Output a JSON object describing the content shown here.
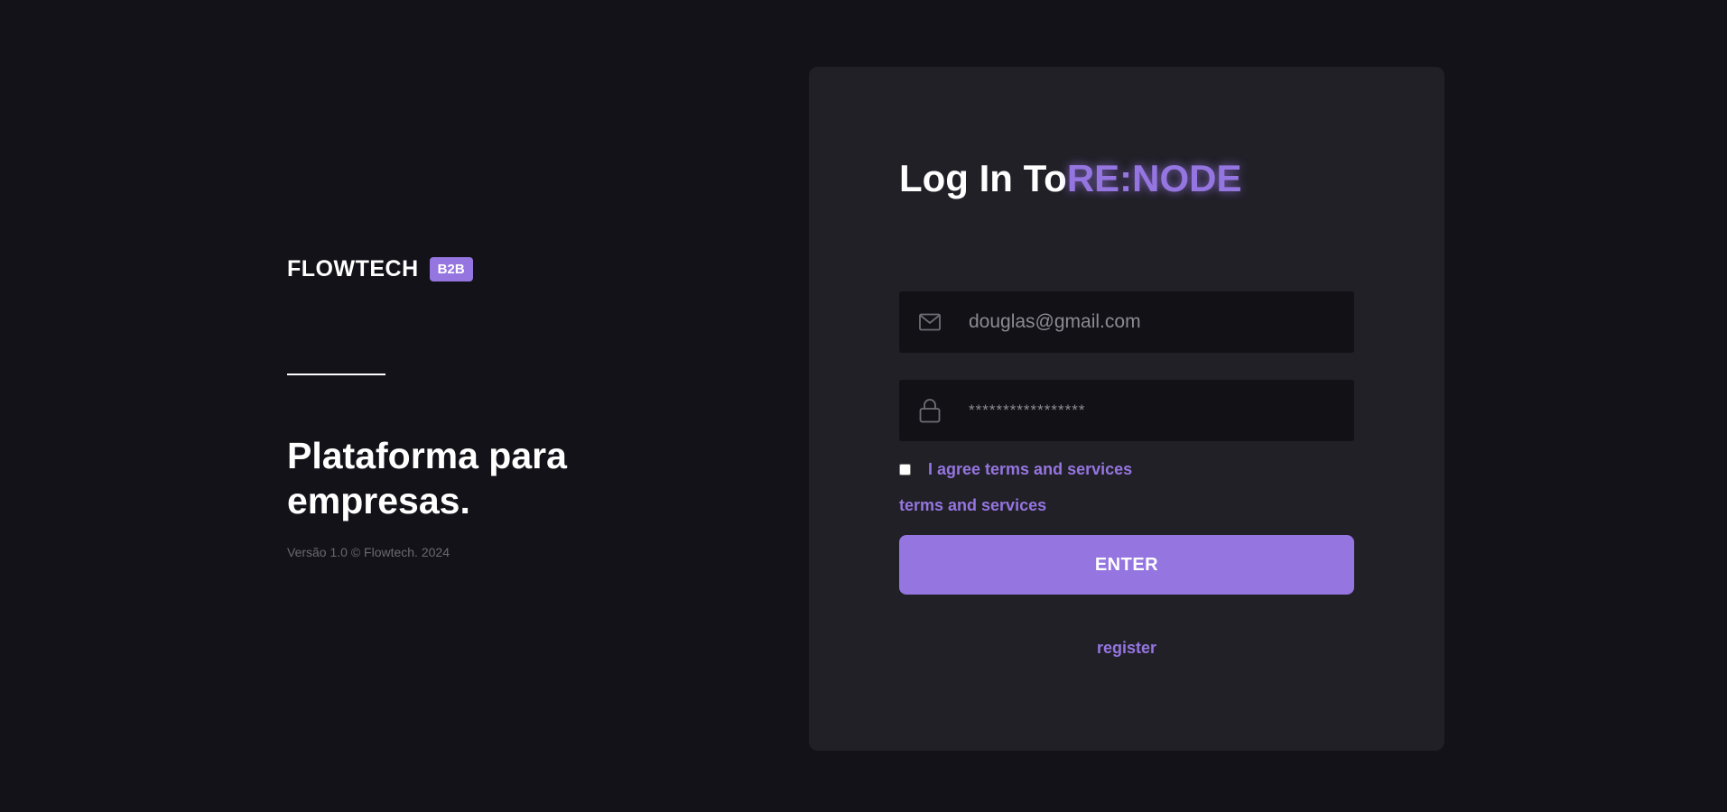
{
  "branding": {
    "name": "FLOWTECH",
    "badge": "B2B",
    "tagline": "Plataforma para empresas.",
    "version": "Versão 1.0 © Flowtech. 2024"
  },
  "login": {
    "title_prefix": "Log In To",
    "title_accent": "RE:NODE",
    "email": {
      "placeholder": "douglas@gmail.com",
      "icon": "mail-icon"
    },
    "password": {
      "placeholder": "*****************",
      "icon": "lock-icon"
    },
    "agree_label": "I agree terms and services",
    "agree_checked": false,
    "terms_link": "terms and services",
    "enter_label": "ENTER",
    "register_link": "register"
  },
  "colors": {
    "background": "#131218",
    "card": "#212027",
    "input": "#121116",
    "accent": "#9575e0",
    "text": "#ffffff",
    "muted": "#6a6972"
  }
}
